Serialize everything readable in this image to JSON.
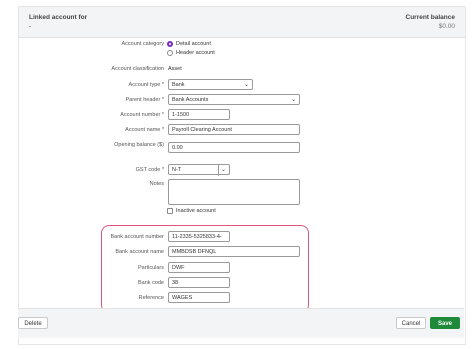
{
  "header": {
    "linked_label": "Linked account for",
    "linked_value": "-",
    "balance_label": "Current balance",
    "balance_value": "$0.00"
  },
  "form": {
    "account_category_label": "Account category",
    "category_options": [
      "Detail account",
      "Header account"
    ],
    "category_selected": "Detail account",
    "account_classification_label": "Account classification",
    "account_classification_value": "Asset",
    "account_type_label": "Account type *",
    "account_type_value": "Bank",
    "parent_header_label": "Parent header *",
    "parent_header_value": "Bank Accounts",
    "account_number_label": "Account number *",
    "account_number_value": "1-1500",
    "account_name_label": "Account name *",
    "account_name_value": "Payroll Clearing Account",
    "opening_balance_label": "Opening balance ($)",
    "opening_balance_value": "0.00",
    "gst_code_label": "GST code *",
    "gst_code_value": "N-T",
    "notes_label": "Notes",
    "notes_value": "",
    "inactive_label": "Inactive account",
    "inactive_checked": false
  },
  "bank": {
    "bsb_label": "Bank account number",
    "bsb_value": "11-2335-5325833-4-",
    "name_label": "Bank account name",
    "name_value": "MMBDSB DFNQL",
    "particulars_label": "Particulars",
    "particulars_value": "DWF",
    "code_label": "Bank code",
    "code_value": "38",
    "reference_label": "Reference",
    "reference_value": "WAGES",
    "highlight_color": "#e0557d"
  },
  "footer": {
    "delete_label": "Delete",
    "cancel_label": "Cancel",
    "save_label": "Save",
    "save_color": "#1f8a3a"
  },
  "icons": {
    "chevron": "chevron-down-icon"
  }
}
